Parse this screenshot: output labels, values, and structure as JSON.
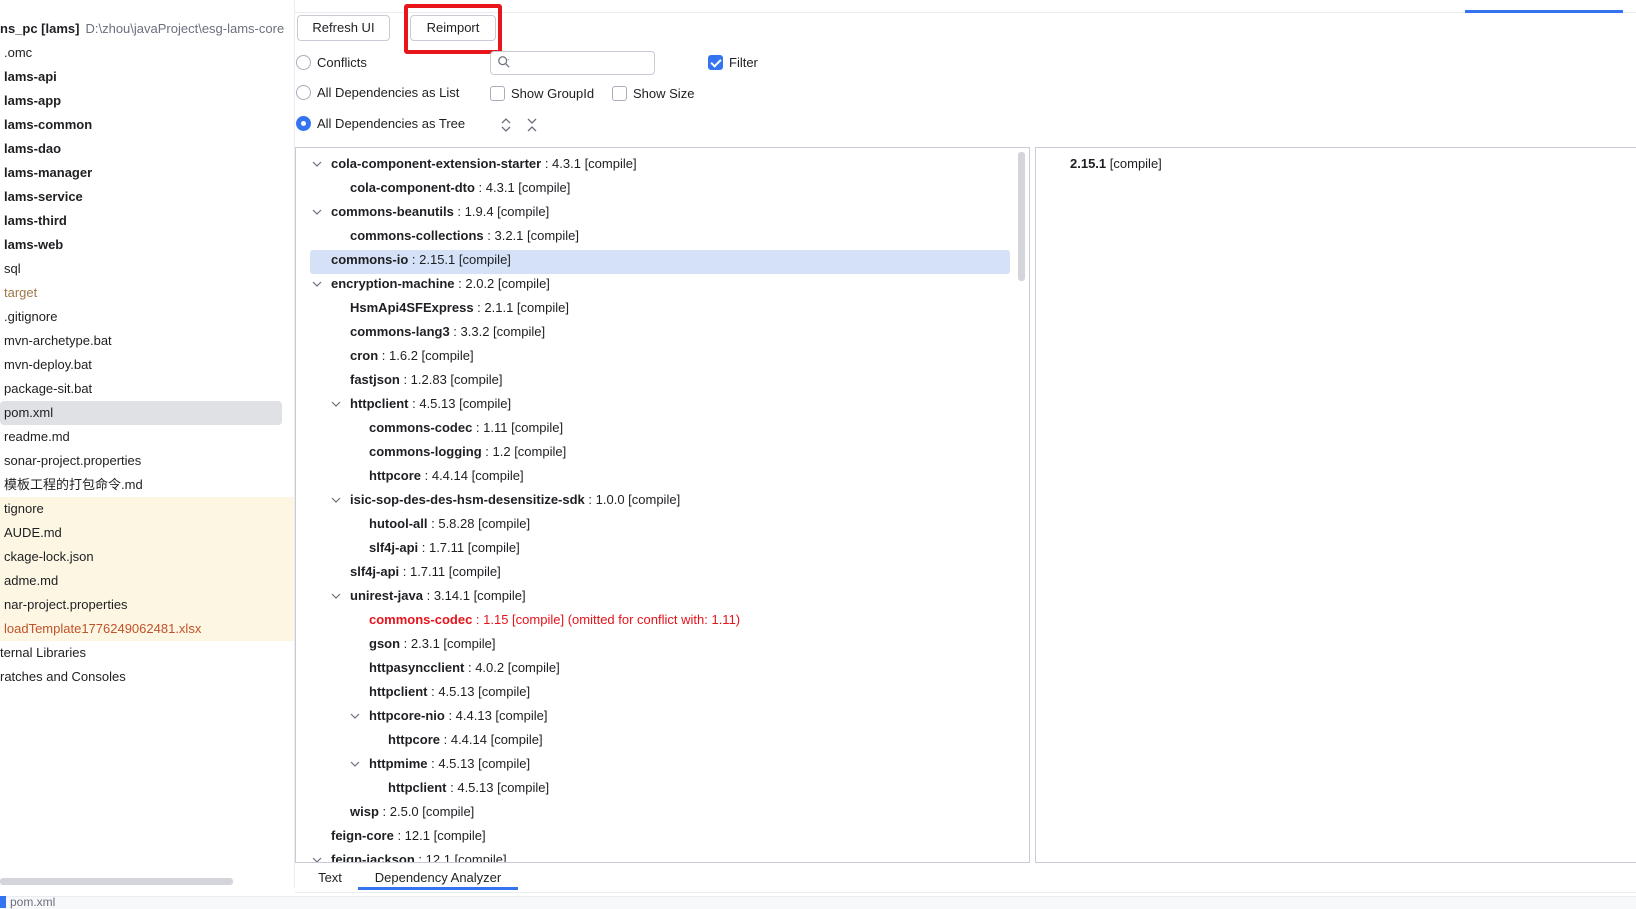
{
  "project": {
    "name": "ns_pc [lams]",
    "path": "D:\\zhou\\javaProject\\esg-lams-core"
  },
  "sidebar": {
    "items": [
      {
        "label": ".omc",
        "kind": "plain"
      },
      {
        "label": "lams-api",
        "kind": "module"
      },
      {
        "label": "lams-app",
        "kind": "module"
      },
      {
        "label": "lams-common",
        "kind": "module"
      },
      {
        "label": "lams-dao",
        "kind": "module"
      },
      {
        "label": "lams-manager",
        "kind": "module"
      },
      {
        "label": "lams-service",
        "kind": "module"
      },
      {
        "label": "lams-third",
        "kind": "module"
      },
      {
        "label": "lams-web",
        "kind": "module"
      },
      {
        "label": "sql",
        "kind": "plain"
      },
      {
        "label": "target",
        "kind": "excluded"
      },
      {
        "label": ".gitignore",
        "kind": "plain"
      },
      {
        "label": "mvn-archetype.bat",
        "kind": "plain"
      },
      {
        "label": "mvn-deploy.bat",
        "kind": "plain"
      },
      {
        "label": "package-sit.bat",
        "kind": "plain"
      },
      {
        "label": "pom.xml",
        "kind": "selected"
      },
      {
        "label": "readme.md",
        "kind": "plain"
      },
      {
        "label": "sonar-project.properties",
        "kind": "plain"
      },
      {
        "label": "模板工程的打包命令.md",
        "kind": "plain"
      },
      {
        "label": "tignore",
        "kind": "ignored"
      },
      {
        "label": "AUDE.md",
        "kind": "ignored"
      },
      {
        "label": "ckage-lock.json",
        "kind": "ignored"
      },
      {
        "label": "adme.md",
        "kind": "ignored"
      },
      {
        "label": "nar-project.properties",
        "kind": "ignored"
      },
      {
        "label": "loadTemplate1776249062481.xlsx",
        "kind": "ignored-excl"
      },
      {
        "label": "ternal Libraries",
        "kind": "cut"
      },
      {
        "label": "ratches and Consoles",
        "kind": "cut"
      }
    ]
  },
  "toolbar": {
    "refresh_label": "Refresh UI",
    "reimport_label": "Reimport"
  },
  "options": {
    "conflicts_label": "Conflicts",
    "list_label": "All Dependencies as List",
    "tree_label": "All Dependencies as Tree",
    "show_groupid_label": "Show GroupId",
    "show_size_label": "Show Size",
    "filter_label": "Filter",
    "search_value": "",
    "search_placeholder": ""
  },
  "dependencies": [
    {
      "name": "cola-component-extension-starter",
      "detail": " : 4.3.1 [compile]",
      "level": 0,
      "expanded": true
    },
    {
      "name": "cola-component-dto",
      "detail": " : 4.3.1 [compile]",
      "level": 1
    },
    {
      "name": "commons-beanutils",
      "detail": " : 1.9.4 [compile]",
      "level": 0,
      "expanded": true
    },
    {
      "name": "commons-collections",
      "detail": " : 3.2.1 [compile]",
      "level": 1
    },
    {
      "name": "commons-io",
      "detail": " : 2.15.1 [compile]",
      "level": 0,
      "selected": true
    },
    {
      "name": "encryption-machine",
      "detail": " : 2.0.2 [compile]",
      "level": 0,
      "expanded": true
    },
    {
      "name": "HsmApi4SFExpress",
      "detail": " : 2.1.1 [compile]",
      "level": 1
    },
    {
      "name": "commons-lang3",
      "detail": " : 3.3.2 [compile]",
      "level": 1
    },
    {
      "name": "cron",
      "detail": " : 1.6.2 [compile]",
      "level": 1
    },
    {
      "name": "fastjson",
      "detail": " : 1.2.83 [compile]",
      "level": 1
    },
    {
      "name": "httpclient",
      "detail": " : 4.5.13 [compile]",
      "level": 1,
      "expanded": true
    },
    {
      "name": "commons-codec",
      "detail": " : 1.11 [compile]",
      "level": 2
    },
    {
      "name": "commons-logging",
      "detail": " : 1.2 [compile]",
      "level": 2
    },
    {
      "name": "httpcore",
      "detail": " : 4.4.14 [compile]",
      "level": 2
    },
    {
      "name": "isic-sop-des-des-hsm-desensitize-sdk",
      "detail": " : 1.0.0 [compile]",
      "level": 1,
      "expanded": true
    },
    {
      "name": "hutool-all",
      "detail": " : 5.8.28 [compile]",
      "level": 2
    },
    {
      "name": "slf4j-api",
      "detail": " : 1.7.11 [compile]",
      "level": 2
    },
    {
      "name": "slf4j-api",
      "detail": " : 1.7.11 [compile]",
      "level": 1
    },
    {
      "name": "unirest-java",
      "detail": " : 3.14.1 [compile]",
      "level": 1,
      "expanded": true
    },
    {
      "name": "commons-codec",
      "detail": " : 1.15 [compile] (omitted for conflict with: 1.11)",
      "level": 2,
      "conflict": true
    },
    {
      "name": "gson",
      "detail": " : 2.3.1 [compile]",
      "level": 2
    },
    {
      "name": "httpasyncclient",
      "detail": " : 4.0.2 [compile]",
      "level": 2
    },
    {
      "name": "httpclient",
      "detail": " : 4.5.13 [compile]",
      "level": 2
    },
    {
      "name": "httpcore-nio",
      "detail": " : 4.4.13 [compile]",
      "level": 2,
      "expanded": true
    },
    {
      "name": "httpcore",
      "detail": " : 4.4.14 [compile]",
      "level": 3
    },
    {
      "name": "httpmime",
      "detail": " : 4.5.13 [compile]",
      "level": 2,
      "expanded": true
    },
    {
      "name": "httpclient",
      "detail": " : 4.5.13 [compile]",
      "level": 3
    },
    {
      "name": "wisp",
      "detail": " : 2.5.0 [compile]",
      "level": 1
    },
    {
      "name": "feign-core",
      "detail": " : 12.1 [compile]",
      "level": 0
    },
    {
      "name": "feign-jackson",
      "detail": " : 12.1 [compile]",
      "level": 0,
      "expanded": true
    }
  ],
  "detail": {
    "version": "2.15.1",
    "scope": " [compile]"
  },
  "bottom_tabs": {
    "text_label": "Text",
    "analyzer_label": "Dependency Analyzer"
  },
  "status": {
    "breadcrumb": "pom.xml"
  },
  "colors": {
    "accent": "#3574f0",
    "conflict": "#e5131a",
    "highlight_box": "#e8151b",
    "selection": "#d5e1f7"
  }
}
